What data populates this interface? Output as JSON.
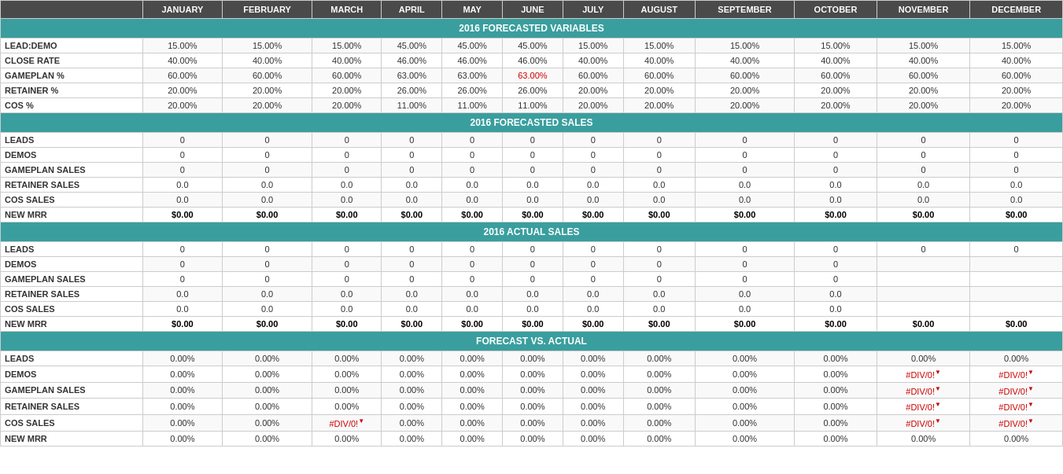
{
  "headers": {
    "col0": "",
    "jan": "JANUARY",
    "feb": "FEBRUARY",
    "mar": "MARCH",
    "apr": "APRIL",
    "may": "MAY",
    "jun": "JUNE",
    "jul": "JULY",
    "aug": "AUGUST",
    "sep": "SEPTEMBER",
    "oct": "OCTOBER",
    "nov": "NOVEMBER",
    "dec": "DECEMBER"
  },
  "sections": {
    "forecasted_variables": "2016 FORECASTED VARIABLES",
    "forecasted_sales": "2016 FORECASTED SALES",
    "actual_sales": "2016 ACTUAL SALES",
    "forecast_vs_actual": "FORECAST VS. ACTUAL"
  },
  "forecasted_variables": {
    "rows": [
      {
        "label": "LEAD:DEMO",
        "values": [
          "15.00%",
          "15.00%",
          "15.00%",
          "45.00%",
          "45.00%",
          "45.00%",
          "15.00%",
          "15.00%",
          "15.00%",
          "15.00%",
          "15.00%",
          "15.00%"
        ]
      },
      {
        "label": "CLOSE RATE",
        "values": [
          "40.00%",
          "40.00%",
          "40.00%",
          "46.00%",
          "46.00%",
          "46.00%",
          "40.00%",
          "40.00%",
          "40.00%",
          "40.00%",
          "40.00%",
          "40.00%"
        ]
      },
      {
        "label": "GAMEPLAN %",
        "values": [
          "60.00%",
          "60.00%",
          "60.00%",
          "63.00%",
          "63.00%",
          "63.00%",
          "60.00%",
          "60.00%",
          "60.00%",
          "60.00%",
          "60.00%",
          "60.00%"
        ],
        "red": [
          false,
          false,
          false,
          false,
          false,
          true,
          false,
          false,
          false,
          false,
          false,
          false
        ]
      },
      {
        "label": "RETAINER %",
        "values": [
          "20.00%",
          "20.00%",
          "20.00%",
          "26.00%",
          "26.00%",
          "26.00%",
          "20.00%",
          "20.00%",
          "20.00%",
          "20.00%",
          "20.00%",
          "20.00%"
        ]
      },
      {
        "label": "COS %",
        "values": [
          "20.00%",
          "20.00%",
          "20.00%",
          "11.00%",
          "11.00%",
          "11.00%",
          "20.00%",
          "20.00%",
          "20.00%",
          "20.00%",
          "20.00%",
          "20.00%"
        ]
      }
    ]
  },
  "forecasted_sales": {
    "rows": [
      {
        "label": "LEADS",
        "values": [
          "0",
          "0",
          "0",
          "0",
          "0",
          "0",
          "0",
          "0",
          "0",
          "0",
          "0",
          "0"
        ]
      },
      {
        "label": "DEMOS",
        "values": [
          "0",
          "0",
          "0",
          "0",
          "0",
          "0",
          "0",
          "0",
          "0",
          "0",
          "0",
          "0"
        ]
      },
      {
        "label": "GAMEPLAN SALES",
        "values": [
          "0",
          "0",
          "0",
          "0",
          "0",
          "0",
          "0",
          "0",
          "0",
          "0",
          "0",
          "0"
        ]
      },
      {
        "label": "RETAINER SALES",
        "values": [
          "0.0",
          "0.0",
          "0.0",
          "0.0",
          "0.0",
          "0.0",
          "0.0",
          "0.0",
          "0.0",
          "0.0",
          "0.0",
          "0.0"
        ]
      },
      {
        "label": "COS SALES",
        "values": [
          "0.0",
          "0.0",
          "0.0",
          "0.0",
          "0.0",
          "0.0",
          "0.0",
          "0.0",
          "0.0",
          "0.0",
          "0.0",
          "0.0"
        ]
      },
      {
        "label": "NEW MRR",
        "values": [
          "$0.00",
          "$0.00",
          "$0.00",
          "$0.00",
          "$0.00",
          "$0.00",
          "$0.00",
          "$0.00",
          "$0.00",
          "$0.00",
          "$0.00",
          "$0.00"
        ],
        "bold": true
      }
    ]
  },
  "actual_sales": {
    "rows": [
      {
        "label": "LEADS",
        "values": [
          "0",
          "0",
          "0",
          "0",
          "0",
          "0",
          "0",
          "0",
          "0",
          "0",
          "0",
          "0"
        ],
        "partial": [
          true,
          true,
          true,
          true,
          true,
          true,
          true,
          true,
          true,
          true,
          false,
          false
        ]
      },
      {
        "label": "DEMOS",
        "values": [
          "0",
          "0",
          "0",
          "0",
          "0",
          "0",
          "0",
          "0",
          "0",
          "0",
          "",
          ""
        ],
        "partial": [
          true,
          true,
          true,
          true,
          true,
          true,
          true,
          true,
          true,
          true,
          false,
          false
        ]
      },
      {
        "label": "GAMEPLAN SALES",
        "values": [
          "0",
          "0",
          "0",
          "0",
          "0",
          "0",
          "0",
          "0",
          "0",
          "0",
          "",
          ""
        ],
        "partial": [
          true,
          true,
          true,
          true,
          true,
          true,
          true,
          true,
          true,
          true,
          false,
          false
        ]
      },
      {
        "label": "RETAINER SALES",
        "values": [
          "0.0",
          "0.0",
          "0.0",
          "0.0",
          "0.0",
          "0.0",
          "0.0",
          "0.0",
          "0.0",
          "0.0",
          "",
          ""
        ],
        "partial": [
          true,
          true,
          true,
          true,
          true,
          true,
          true,
          true,
          true,
          true,
          false,
          false
        ]
      },
      {
        "label": "COS SALES",
        "values": [
          "0.0",
          "0.0",
          "0.0",
          "0.0",
          "0.0",
          "0.0",
          "0.0",
          "0.0",
          "0.0",
          "0.0",
          "",
          ""
        ],
        "partial": [
          true,
          true,
          true,
          true,
          true,
          true,
          true,
          true,
          true,
          true,
          false,
          false
        ]
      },
      {
        "label": "NEW MRR",
        "values": [
          "$0.00",
          "$0.00",
          "$0.00",
          "$0.00",
          "$0.00",
          "$0.00",
          "$0.00",
          "$0.00",
          "$0.00",
          "$0.00",
          "$0.00",
          "$0.00"
        ],
        "bold": true
      }
    ]
  },
  "forecast_vs_actual": {
    "rows": [
      {
        "label": "LEADS",
        "values": [
          "0.00%",
          "0.00%",
          "0.00%",
          "0.00%",
          "0.00%",
          "0.00%",
          "0.00%",
          "0.00%",
          "0.00%",
          "0.00%",
          "0.00%",
          "0.00%"
        ]
      },
      {
        "label": "DEMOS",
        "values": [
          "0.00%",
          "0.00%",
          "0.00%",
          "0.00%",
          "0.00%",
          "0.00%",
          "0.00%",
          "0.00%",
          "0.00%",
          "0.00%",
          "#DIV/0!",
          "#DIV/0!"
        ],
        "error": [
          false,
          false,
          false,
          false,
          false,
          false,
          false,
          false,
          false,
          false,
          true,
          true
        ]
      },
      {
        "label": "GAMEPLAN SALES",
        "values": [
          "0.00%",
          "0.00%",
          "0.00%",
          "0.00%",
          "0.00%",
          "0.00%",
          "0.00%",
          "0.00%",
          "0.00%",
          "0.00%",
          "#DIV/0!",
          "#DIV/0!"
        ],
        "error": [
          false,
          false,
          false,
          false,
          false,
          false,
          false,
          false,
          false,
          false,
          true,
          true
        ]
      },
      {
        "label": "RETAINER SALES",
        "values": [
          "0.00%",
          "0.00%",
          "0.00%",
          "0.00%",
          "0.00%",
          "0.00%",
          "0.00%",
          "0.00%",
          "0.00%",
          "0.00%",
          "#DIV/0!",
          "#DIV/0!"
        ],
        "error": [
          false,
          false,
          false,
          false,
          false,
          false,
          false,
          false,
          false,
          false,
          true,
          true
        ]
      },
      {
        "label": "COS SALES",
        "values": [
          "0.00%",
          "0.00%",
          "#DIV/0!",
          "0.00%",
          "0.00%",
          "0.00%",
          "0.00%",
          "0.00%",
          "0.00%",
          "0.00%",
          "#DIV/0!",
          "#DIV/0!"
        ],
        "error": [
          false,
          false,
          true,
          false,
          false,
          false,
          false,
          false,
          false,
          false,
          true,
          true
        ]
      },
      {
        "label": "NEW MRR",
        "values": [
          "0.00%",
          "0.00%",
          "0.00%",
          "0.00%",
          "0.00%",
          "0.00%",
          "0.00%",
          "0.00%",
          "0.00%",
          "0.00%",
          "0.00%",
          "0.00%"
        ]
      }
    ]
  }
}
